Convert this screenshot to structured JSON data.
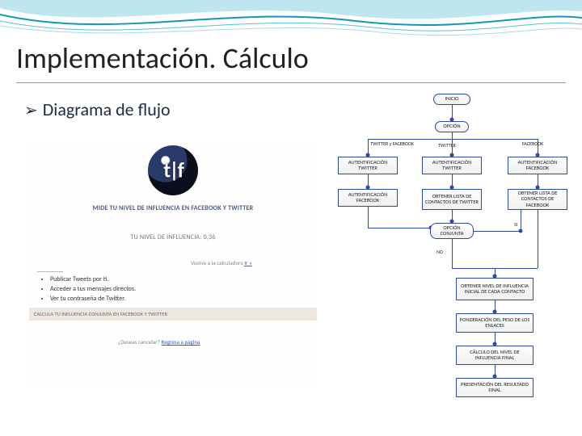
{
  "slide": {
    "title": "Implementación. Cálculo",
    "bullet": "Diagrama de flujo"
  },
  "mock": {
    "tagline": "MIDE TU NIVEL DE INFLUENCIA EN FACEBOOK Y TWITTER",
    "level": "TU NIVEL DE INFLUENCIA: 0,36",
    "sidelink_prefix": "Vuelve a la calculadora",
    "sidelink_link": "Ir »",
    "perm1": "Publicar Tweets por ti.",
    "perm2": "Acceder a tus mensajes directos.",
    "perm3": "Ver tu contraseña de Twitter.",
    "bar": "CALCULA TU INFLUENCIA CONJUNTA EN FACEBOOK Y TWITTER",
    "foot_prefix": "¿Deseas cancelar?",
    "foot_link": "Regresa a pagina"
  },
  "flow": {
    "inicio": "INICIO",
    "opcion": "OPCIÓN",
    "branch_left": "TWITTER y FACEBOOK",
    "branch_mid": "TWITTER",
    "branch_right": "FACEBOOK",
    "auth_tw_l": "AUTENTIFICACIÓN TWITTER",
    "auth_fb_l": "AUTENTIFICACIÓN FACEBOOK",
    "auth_tw_m": "AUTENTIFICACIÓN TWITTER",
    "contacts_tw": "OBTENER LISTA DE CONTACTOS DE TWITTER",
    "auth_fb_r": "AUTENTIFICACIÓN FACEBOOK",
    "contacts_fb": "OBTENER LISTA DE CONTACTOS DE FACEBOOK",
    "opcion_conj": "OPCIÓN CONJUNTA",
    "si": "SI",
    "no": "NO",
    "nivel_inicial": "OBTENER NIVEL DE INFLUENCIA INICIAL DE CADA CONTACTO",
    "ponderacion": "PONDERACIÓN DEL PESO DE LOS ENLACES",
    "calculo": "CÁLCULO DEL NIVEL DE INFLUENCIA FINAL",
    "presentacion": "PRESENTACIÓN DEL RESULTADO FINAL"
  }
}
